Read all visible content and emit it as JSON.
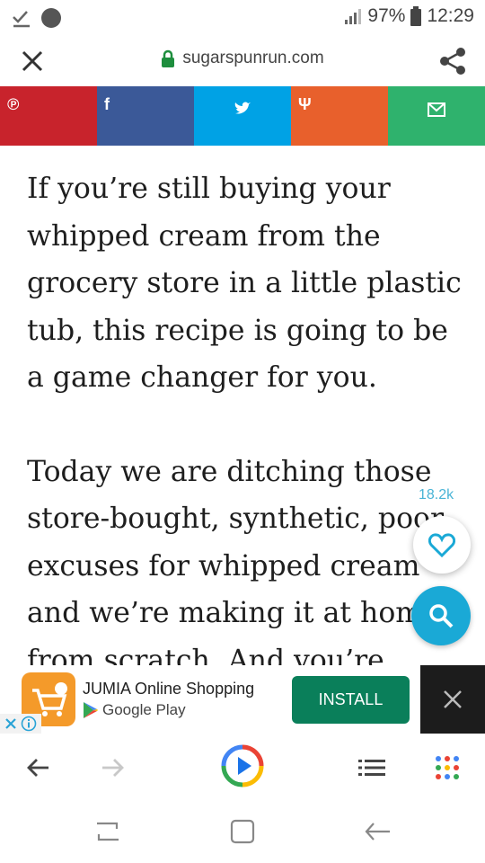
{
  "status_bar": {
    "battery": "97%",
    "time": "12:29"
  },
  "url_bar": {
    "domain": "sugarspunrun.com"
  },
  "share_strip": {
    "colors": [
      "#c8232c",
      "#3b5998",
      "#00a2e5",
      "#e8602c",
      "#2fb26d"
    ],
    "icons": [
      "pinterest-icon",
      "facebook-icon",
      "twitter-icon",
      "yummly-icon",
      "email-icon"
    ]
  },
  "article": {
    "paragraphs": [
      "If you’re still buying your whipped cream from the grocery store in a little plastic tub, this recipe is going to be a game changer for you.",
      "Today we are ditching those store-bought, synthetic, poor excuses for whipped cream and we’re making it at home from scratch. And you’re"
    ]
  },
  "floating": {
    "save_count": "18.2k"
  },
  "ad": {
    "app_name": "JUMIA Online Shopping",
    "store": "Google Play",
    "install_label": "INSTALL"
  },
  "colors": {
    "install_button": "#0a7f5a",
    "search_fab": "#1aa9d6",
    "count_text": "#49b4d6"
  }
}
